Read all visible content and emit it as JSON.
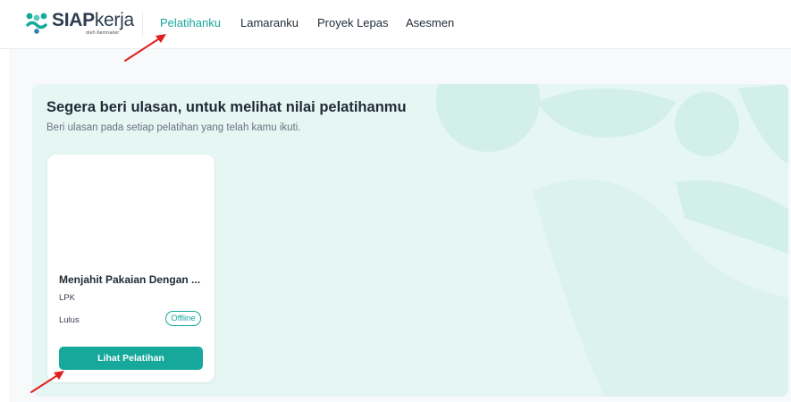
{
  "header": {
    "logo": {
      "brand_bold": "SIAP",
      "brand_regular": "kerja",
      "sub": "oleh Kemnaker"
    },
    "nav": [
      {
        "label": "Pelatihanku",
        "active": true
      },
      {
        "label": "Lamaranku",
        "active": false
      },
      {
        "label": "Proyek Lepas",
        "active": false
      },
      {
        "label": "Asesmen",
        "active": false
      }
    ]
  },
  "banner": {
    "title": "Segera beri ulasan, untuk melihat nilai pelatihanmu",
    "subtitle": "Beri ulasan pada setiap pelatihan yang telah kamu ikuti."
  },
  "card": {
    "title": "Menjahit Pakaian Dengan ...",
    "provider": "LPK",
    "status": "Lulus",
    "mode_badge": "Offline",
    "button_label": "Lihat Pelatihan"
  },
  "colors": {
    "accent": "#15a89b",
    "panel_bg": "#e6f6f3",
    "annotation_arrow": "#e02020"
  }
}
